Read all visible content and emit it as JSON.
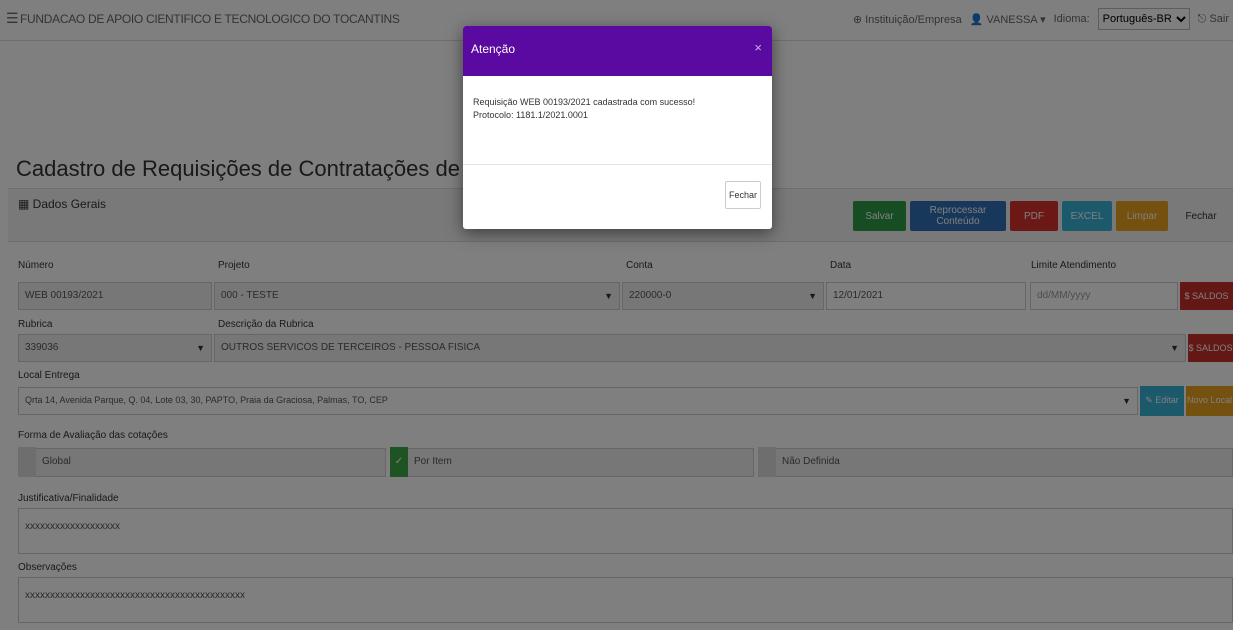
{
  "topbar": {
    "menu_icon": "hamburger-icon",
    "org_name": "FUNDACAO DE APOIO CIENTIFICO E TECNOLOGICO DO TOCANTINS",
    "institution_link": "Instituição/Empresa",
    "user": "VANESSA",
    "language_label": "Idioma:",
    "language_value": "Português-BR",
    "exit_label": "Sair"
  },
  "page": {
    "title": "Cadastro de Requisições de Contratações de Serviços de Pessoa"
  },
  "panel": {
    "title": "Dados Gerais",
    "buttons": {
      "salvar": "Salvar",
      "reprocessar": "Reprocessar Conteúdo",
      "pdf": "PDF",
      "excel": "EXCEL",
      "limpar": "Limpar",
      "fechar": "Fechar"
    }
  },
  "form": {
    "numero": {
      "label": "Número",
      "value": "WEB 00193/2021"
    },
    "projeto": {
      "label": "Projeto",
      "value": "000 - TESTE"
    },
    "conta": {
      "label": "Conta",
      "value": "220000-0"
    },
    "data": {
      "label": "Data",
      "value": "12/01/2021"
    },
    "limite": {
      "label": "Limite Atendimento",
      "placeholder": "dd/MM/yyyy",
      "button": "$ SALDOS"
    },
    "rubrica": {
      "label": "Rubrica",
      "value": "339036"
    },
    "descricao_rubrica": {
      "label": "Descrição da Rubrica",
      "value": "OUTROS SERVICOS DE TERCEIROS - PESSOA FISICA",
      "button": "$ SALDOS"
    },
    "local_entrega": {
      "label": "Local Entrega",
      "value": "Qrta 14, Avenida Parque, Q. 04, Lote 03, 30, PAPTO, Praia da Graciosa, Palmas, TO, CEP",
      "edit_button": "Editar",
      "new_button": "Novo Local"
    },
    "forma_avaliacao": {
      "label": "Forma de Avaliação das cotações",
      "options": [
        "Global",
        "Por Item",
        "Não Definida"
      ]
    },
    "justificativa": {
      "label": "Justificativa/Finalidade",
      "value": "xxxxxxxxxxxxxxxxxxx"
    },
    "observacoes": {
      "label": "Observações",
      "value": "xxxxxxxxxxxxxxxxxxxxxxxxxxxxxxxxxxxxxxxxxxxx"
    }
  },
  "modal": {
    "title": "Atenção",
    "close_icon": "×",
    "line1": "Requisição WEB 00193/2021 cadastrada com sucesso!",
    "line2": "Protocolo: 1181.1/2021.0001",
    "close_button": "Fechar"
  },
  "colors": {
    "modal_header": "#5a0aa0",
    "salvar": "#2e9a45",
    "reprocessar": "#2f6fb6",
    "pdf": "#d9302c",
    "excel": "#38b3d6",
    "limpar": "#e8a21c",
    "saldos": "#c9302c"
  }
}
